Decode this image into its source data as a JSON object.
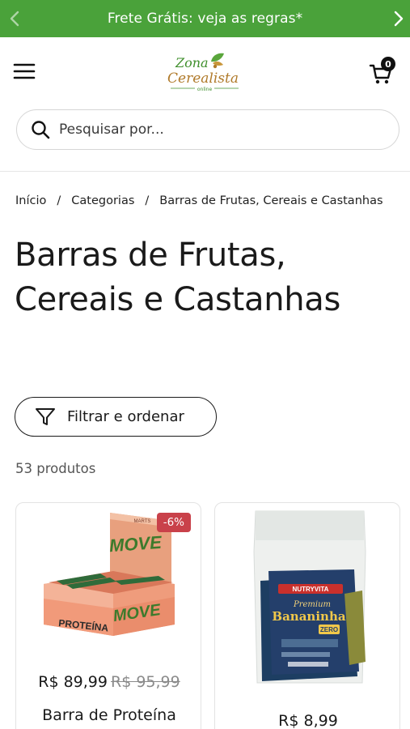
{
  "promo": {
    "text": "Frete Grátis: veja as regras*"
  },
  "header": {
    "logo_line1": "Zona",
    "logo_line2": "Cerealista",
    "logo_line3": "online",
    "cart_count": "0"
  },
  "search": {
    "placeholder": "Pesquisar por..."
  },
  "breadcrumb": {
    "items": [
      "Início",
      "Categorias",
      "Barras de Frutas, Cereais e Castanhas"
    ],
    "separator": "/"
  },
  "page": {
    "title": "Barras de Frutas, Cereais e Castanhas",
    "filter_label": "Filtrar e ordenar",
    "product_count": "53 produtos"
  },
  "products": [
    {
      "name": "Barra de Proteína",
      "price": "R$ 89,99",
      "old_price": "R$ 95,99",
      "badge": "-6%",
      "box_brand": "MOVE",
      "box_label": "PROTEÍNA",
      "box_maker": "MARTS"
    },
    {
      "price": "R$ 8,99",
      "pack_brand": "NUTRYVITA",
      "pack_line1": "Premium",
      "pack_line2": "Bananinha",
      "pack_zero": "ZERO"
    }
  ],
  "colors": {
    "promo_bg": "#4aa23a",
    "badge_bg": "#c9414a",
    "logo_green": "#3f8f2c",
    "logo_brown": "#b07a2a"
  }
}
